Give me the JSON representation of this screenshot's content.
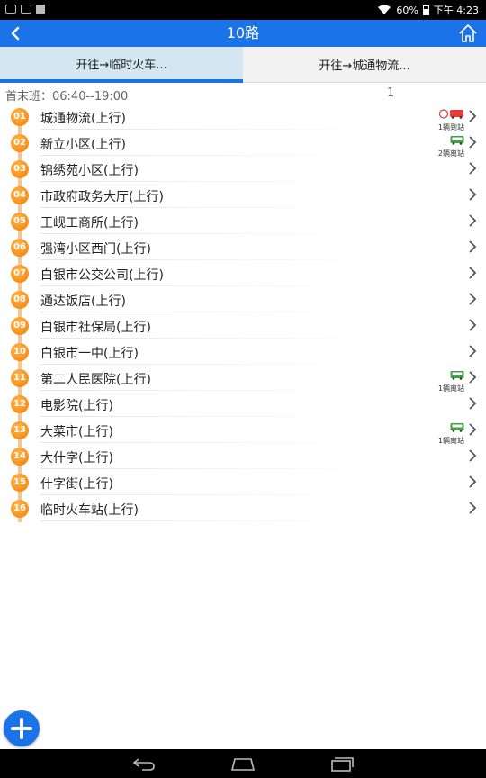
{
  "status_bar": {
    "battery": "60%",
    "time": "下午 4:23"
  },
  "app_bar": {
    "title": "10路"
  },
  "tabs": [
    {
      "label": "开往→临时火车...",
      "active": true
    },
    {
      "label": "开往→城通物流...",
      "active": false
    }
  ],
  "schedule": {
    "text": "首末班：06:40--19:00",
    "count": "1"
  },
  "stops": [
    {
      "num": "01",
      "name": "城通物流(上行)",
      "bus": "1辆到站",
      "bus_state": "arrived"
    },
    {
      "num": "02",
      "name": "新立小区(上行)",
      "bus": "2辆离站",
      "bus_state": "departed"
    },
    {
      "num": "03",
      "name": "锦绣苑小区(上行)"
    },
    {
      "num": "04",
      "name": "市政府政务大厅(上行)"
    },
    {
      "num": "05",
      "name": "王岘工商所(上行)"
    },
    {
      "num": "06",
      "name": "强湾小区西门(上行)"
    },
    {
      "num": "07",
      "name": "白银市公交公司(上行)"
    },
    {
      "num": "08",
      "name": "通达饭店(上行)"
    },
    {
      "num": "09",
      "name": "白银市社保局(上行)"
    },
    {
      "num": "10",
      "name": "白银市一中(上行)"
    },
    {
      "num": "11",
      "name": "第二人民医院(上行)",
      "bus": "1辆离站",
      "bus_state": "departed"
    },
    {
      "num": "12",
      "name": "电影院(上行)"
    },
    {
      "num": "13",
      "name": "大菜市(上行)",
      "bus": "1辆离站",
      "bus_state": "departed"
    },
    {
      "num": "14",
      "name": "大什字(上行)"
    },
    {
      "num": "15",
      "name": "什字街(上行)"
    },
    {
      "num": "16",
      "name": "临时火车站(上行)"
    }
  ],
  "colors": {
    "accent": "#1a73e8",
    "badge": "#f57c00",
    "bus_arrived": "#e53935",
    "bus_departed": "#43a047"
  },
  "icons": {
    "back": "chevron-left-icon",
    "home": "home-icon",
    "add": "plus-icon",
    "nav": [
      "back-icon",
      "home-icon",
      "recents-icon"
    ]
  }
}
